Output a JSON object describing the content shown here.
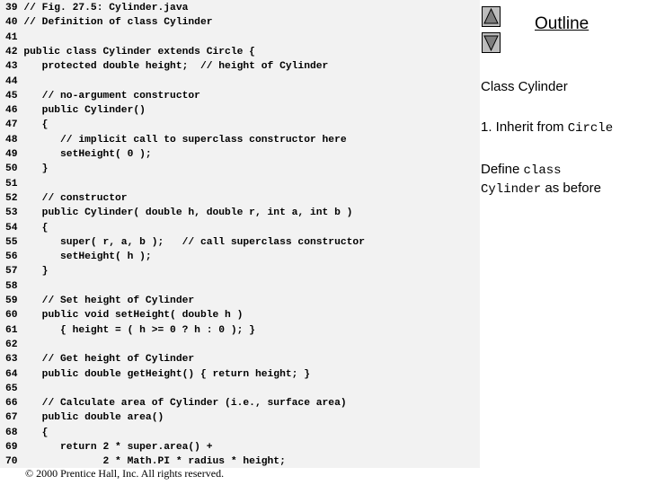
{
  "code": {
    "lines": [
      {
        "num": "39",
        "text": "// Fig. 27.5: Cylinder.java"
      },
      {
        "num": "40",
        "text": "// Definition of class Cylinder"
      },
      {
        "num": "41",
        "text": ""
      },
      {
        "num": "42",
        "text": "public class Cylinder extends Circle {"
      },
      {
        "num": "43",
        "text": "   protected double height;  // height of Cylinder"
      },
      {
        "num": "44",
        "text": ""
      },
      {
        "num": "45",
        "text": "   // no-argument constructor"
      },
      {
        "num": "46",
        "text": "   public Cylinder()"
      },
      {
        "num": "47",
        "text": "   {"
      },
      {
        "num": "48",
        "text": "      // implicit call to superclass constructor here"
      },
      {
        "num": "49",
        "text": "      setHeight( 0 );"
      },
      {
        "num": "50",
        "text": "   }"
      },
      {
        "num": "51",
        "text": ""
      },
      {
        "num": "52",
        "text": "   // constructor"
      },
      {
        "num": "53",
        "text": "   public Cylinder( double h, double r, int a, int b )"
      },
      {
        "num": "54",
        "text": "   {"
      },
      {
        "num": "55",
        "text": "      super( r, a, b );   // call superclass constructor"
      },
      {
        "num": "56",
        "text": "      setHeight( h );"
      },
      {
        "num": "57",
        "text": "   }"
      },
      {
        "num": "58",
        "text": ""
      },
      {
        "num": "59",
        "text": "   // Set height of Cylinder"
      },
      {
        "num": "60",
        "text": "   public void setHeight( double h )"
      },
      {
        "num": "61",
        "text": "      { height = ( h >= 0 ? h : 0 ); }"
      },
      {
        "num": "62",
        "text": ""
      },
      {
        "num": "63",
        "text": "   // Get height of Cylinder"
      },
      {
        "num": "64",
        "text": "   public double getHeight() { return height; }"
      },
      {
        "num": "65",
        "text": ""
      },
      {
        "num": "66",
        "text": "   // Calculate area of Cylinder (i.e., surface area)"
      },
      {
        "num": "67",
        "text": "   public double area()"
      },
      {
        "num": "68",
        "text": "   {"
      },
      {
        "num": "69",
        "text": "      return 2 * super.area() +"
      },
      {
        "num": "70",
        "text": "             2 * Math.PI * radius * height;"
      }
    ]
  },
  "outline": {
    "title": "Outline",
    "up_icon": "triangle-up-icon",
    "down_icon": "triangle-down-icon"
  },
  "notes": {
    "class_heading": "Class Cylinder",
    "inherit_prefix": "1. Inherit from ",
    "inherit_code": "Circle",
    "define_prefix": "Define ",
    "define_code_1": "class",
    "define_code_2": "Cylinder",
    "define_suffix": " as before"
  },
  "footer": {
    "text": "© 2000 Prentice Hall, Inc.  All rights reserved."
  }
}
